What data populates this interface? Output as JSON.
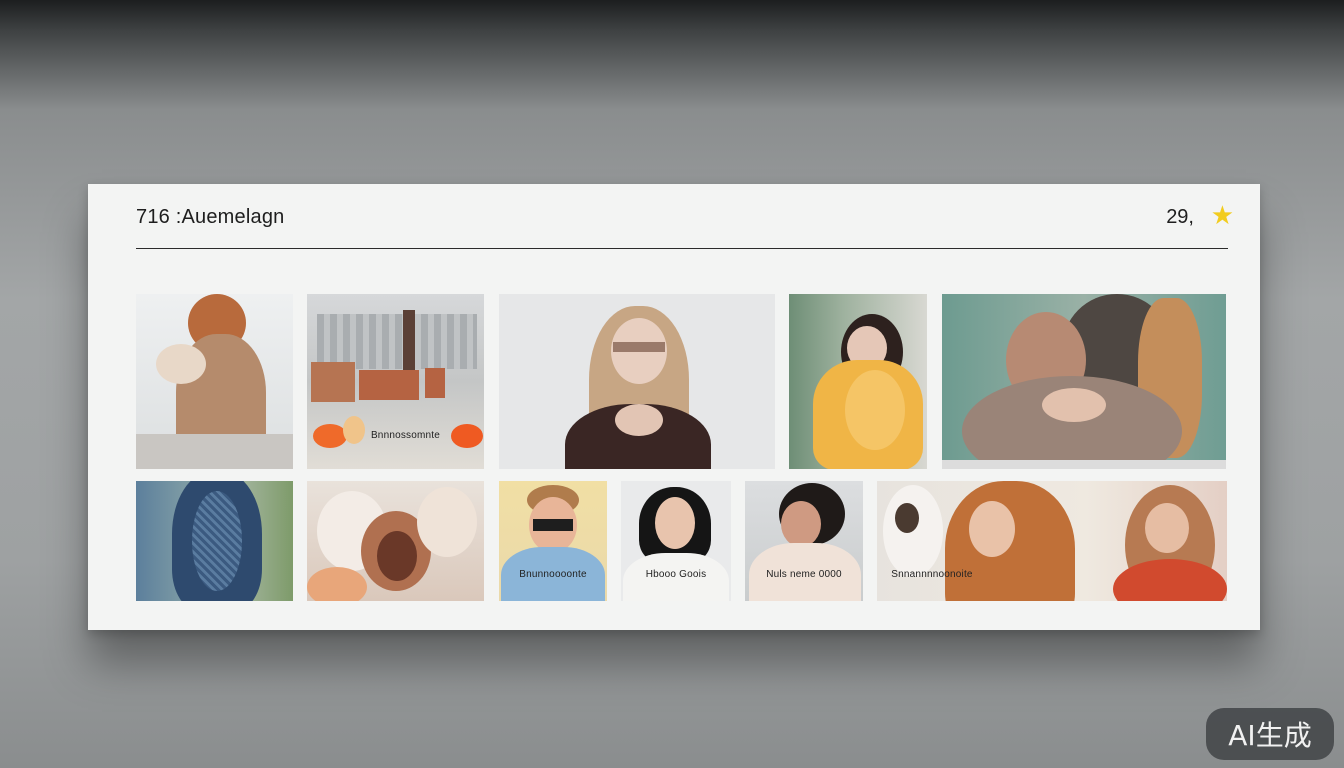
{
  "header": {
    "title": "716 :Auemelagn",
    "count": "29,",
    "star_color": "#f2cc1e"
  },
  "gallery": {
    "row1": [
      {
        "name": "photo-knit-figure"
      },
      {
        "name": "photo-city-scene",
        "caption": "Bnnnossomnte"
      },
      {
        "name": "photo-woman-long-hair"
      },
      {
        "name": "photo-woman-yellow-sweater"
      },
      {
        "name": "photo-woman-wrapped"
      }
    ],
    "row2": [
      {
        "name": "photo-lace-dress"
      },
      {
        "name": "photo-ceramics"
      },
      {
        "name": "photo-boy",
        "caption": "Bnunnoooonte"
      },
      {
        "name": "photo-woman-portrait",
        "caption": "Hbooo Goois"
      },
      {
        "name": "photo-curly-hair",
        "caption": "Nuls neme 0000"
      },
      {
        "name": "photo-group-redhair",
        "caption": "Snnannnnoonoite"
      }
    ]
  },
  "watermark": {
    "label": "AI生成"
  }
}
